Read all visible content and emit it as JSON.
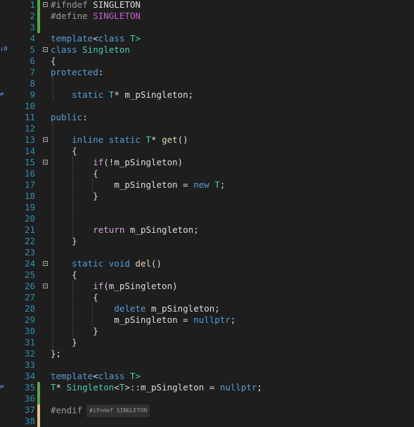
{
  "editor": {
    "lines": [
      {
        "n": "1",
        "tokens": [
          {
            "t": "#ifndef ",
            "c": "pp"
          },
          {
            "t": "SINGLETON",
            "c": "tx"
          }
        ]
      },
      {
        "n": "2",
        "tokens": [
          {
            "t": "#define ",
            "c": "pp"
          },
          {
            "t": "SINGLETON",
            "c": "mac"
          }
        ]
      },
      {
        "n": "3",
        "tokens": []
      },
      {
        "n": "4",
        "tokens": [
          {
            "t": "template",
            "c": "kw"
          },
          {
            "t": "<",
            "c": "tx"
          },
          {
            "t": "class",
            "c": "kw"
          },
          {
            "t": " T>",
            "c": "ty"
          }
        ]
      },
      {
        "n": "5",
        "tokens": [
          {
            "t": "class ",
            "c": "kw"
          },
          {
            "t": "Singleton",
            "c": "ty"
          }
        ]
      },
      {
        "n": "6",
        "tokens": [
          {
            "t": "{",
            "c": "tx"
          }
        ]
      },
      {
        "n": "7",
        "tokens": [
          {
            "t": "protected",
            "c": "kw"
          },
          {
            "t": ":",
            "c": "tx"
          }
        ]
      },
      {
        "n": "8",
        "tokens": []
      },
      {
        "n": "9",
        "tokens": [
          {
            "t": "    static ",
            "c": "kw"
          },
          {
            "t": "T",
            "c": "ty"
          },
          {
            "t": "* m_pSingleton;",
            "c": "tx"
          }
        ]
      },
      {
        "n": "10",
        "tokens": []
      },
      {
        "n": "11",
        "tokens": [
          {
            "t": "public",
            "c": "kw"
          },
          {
            "t": ":",
            "c": "tx"
          }
        ]
      },
      {
        "n": "12",
        "tokens": []
      },
      {
        "n": "13",
        "tokens": [
          {
            "t": "    inline static ",
            "c": "kw"
          },
          {
            "t": "T",
            "c": "ty"
          },
          {
            "t": "* ",
            "c": "tx"
          },
          {
            "t": "get",
            "c": "fn"
          },
          {
            "t": "()",
            "c": "tx"
          }
        ]
      },
      {
        "n": "14",
        "tokens": [
          {
            "t": "    {",
            "c": "tx"
          }
        ]
      },
      {
        "n": "15",
        "tokens": [
          {
            "t": "        if",
            "c": "ck"
          },
          {
            "t": "(!m_pSingleton)",
            "c": "tx"
          }
        ]
      },
      {
        "n": "16",
        "tokens": [
          {
            "t": "        {",
            "c": "tx"
          }
        ]
      },
      {
        "n": "17",
        "tokens": [
          {
            "t": "            m_pSingleton = ",
            "c": "tx"
          },
          {
            "t": "new ",
            "c": "kw"
          },
          {
            "t": "T",
            "c": "ty"
          },
          {
            "t": ";",
            "c": "tx"
          }
        ]
      },
      {
        "n": "18",
        "tokens": [
          {
            "t": "        }",
            "c": "tx"
          }
        ]
      },
      {
        "n": "19",
        "tokens": []
      },
      {
        "n": "20",
        "tokens": []
      },
      {
        "n": "21",
        "tokens": [
          {
            "t": "        return ",
            "c": "ck"
          },
          {
            "t": "m_pSingleton;",
            "c": "tx"
          }
        ]
      },
      {
        "n": "22",
        "tokens": [
          {
            "t": "    }",
            "c": "tx"
          }
        ]
      },
      {
        "n": "23",
        "tokens": []
      },
      {
        "n": "24",
        "tokens": [
          {
            "t": "    static void ",
            "c": "kw"
          },
          {
            "t": "del",
            "c": "fn"
          },
          {
            "t": "()",
            "c": "tx"
          }
        ]
      },
      {
        "n": "25",
        "tokens": [
          {
            "t": "    {",
            "c": "tx"
          }
        ]
      },
      {
        "n": "26",
        "tokens": [
          {
            "t": "        if",
            "c": "ck"
          },
          {
            "t": "(m_pSingleton)",
            "c": "tx"
          }
        ]
      },
      {
        "n": "27",
        "tokens": [
          {
            "t": "        {",
            "c": "tx"
          }
        ]
      },
      {
        "n": "28",
        "tokens": [
          {
            "t": "            delete ",
            "c": "kw"
          },
          {
            "t": "m_pSingleton;",
            "c": "tx"
          }
        ]
      },
      {
        "n": "29",
        "tokens": [
          {
            "t": "            m_pSingleton = ",
            "c": "tx"
          },
          {
            "t": "nullptr",
            "c": "kw"
          },
          {
            "t": ";",
            "c": "tx"
          }
        ]
      },
      {
        "n": "30",
        "tokens": [
          {
            "t": "        }",
            "c": "tx"
          }
        ]
      },
      {
        "n": "31",
        "tokens": [
          {
            "t": "    }",
            "c": "tx"
          }
        ]
      },
      {
        "n": "32",
        "tokens": [
          {
            "t": "};",
            "c": "tx"
          }
        ]
      },
      {
        "n": "33",
        "tokens": []
      },
      {
        "n": "34",
        "tokens": [
          {
            "t": "template",
            "c": "kw"
          },
          {
            "t": "<",
            "c": "tx"
          },
          {
            "t": "class",
            "c": "kw"
          },
          {
            "t": " T>",
            "c": "ty"
          }
        ]
      },
      {
        "n": "35",
        "tokens": [
          {
            "t": "T",
            "c": "ty"
          },
          {
            "t": "* ",
            "c": "tx"
          },
          {
            "t": "Singleton",
            "c": "ty"
          },
          {
            "t": "<",
            "c": "tx"
          },
          {
            "t": "T",
            "c": "ty"
          },
          {
            "t": ">::m_pSingleton = ",
            "c": "tx"
          },
          {
            "t": "nullptr",
            "c": "kw"
          },
          {
            "t": ";",
            "c": "tx"
          }
        ]
      },
      {
        "n": "36",
        "tokens": []
      },
      {
        "n": "37",
        "tokens": [
          {
            "t": "#endif",
            "c": "pp"
          }
        ]
      },
      {
        "n": "38",
        "tokens": []
      }
    ],
    "endif_hint": "#ifndef SINGLETON",
    "gutter_icons": [
      {
        "line": 5,
        "glyph": "↓0"
      },
      {
        "line": 9,
        "glyph": "⇄"
      },
      {
        "line": 35,
        "glyph": "⇄"
      }
    ],
    "fold_lines": [
      1,
      5,
      13,
      15,
      24,
      26
    ],
    "change_bars": [
      {
        "from": 1,
        "to": 3,
        "color": "#57a64a"
      },
      {
        "from": 35,
        "to": 36,
        "color": "#57a64a"
      },
      {
        "from": 37,
        "to": 38,
        "color": "#e2c08d"
      }
    ]
  }
}
